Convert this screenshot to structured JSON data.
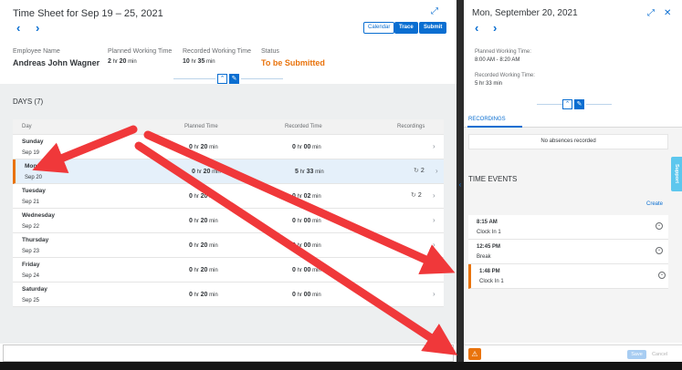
{
  "left": {
    "title": "Time Sheet for Sep 19 – 25, 2021",
    "buttons": {
      "calendar": "Calendar",
      "trace": "Trace",
      "submit": "Submit"
    },
    "employee": {
      "label": "Employee Name",
      "value": "Andreas John Wagner"
    },
    "planned": {
      "label": "Planned Working Time",
      "hr": "2",
      "hr_unit": "hr",
      "min": "20",
      "min_unit": "min"
    },
    "recorded": {
      "label": "Recorded Working Time",
      "hr": "10",
      "hr_unit": "hr",
      "min": "35",
      "min_unit": "min"
    },
    "status": {
      "label": "Status",
      "value": "To be Submitted"
    },
    "days_title": "DAYS (7)",
    "columns": {
      "day": "Day",
      "planned": "Planned Time",
      "recorded": "Recorded Time",
      "recordings": "Recordings"
    },
    "days": [
      {
        "day": "Sunday",
        "date": "Sep 19",
        "p_hr": "0",
        "p_min": "20",
        "r_hr": "0",
        "r_min": "00",
        "rec": "",
        "selected": false
      },
      {
        "day": "Monday",
        "date": "Sep 20",
        "p_hr": "0",
        "p_min": "20",
        "r_hr": "5",
        "r_min": "33",
        "rec": "2",
        "selected": true
      },
      {
        "day": "Tuesday",
        "date": "Sep 21",
        "p_hr": "0",
        "p_min": "20",
        "r_hr": "0",
        "r_min": "02",
        "rec": "2",
        "selected": false
      },
      {
        "day": "Wednesday",
        "date": "Sep 22",
        "p_hr": "0",
        "p_min": "20",
        "r_hr": "0",
        "r_min": "00",
        "rec": "",
        "selected": false
      },
      {
        "day": "Thursday",
        "date": "Sep 23",
        "p_hr": "0",
        "p_min": "20",
        "r_hr": "0",
        "r_min": "00",
        "rec": "",
        "selected": false
      },
      {
        "day": "Friday",
        "date": "Sep 24",
        "p_hr": "0",
        "p_min": "20",
        "r_hr": "0",
        "r_min": "00",
        "rec": "",
        "selected": false
      },
      {
        "day": "Saturday",
        "date": "Sep 25",
        "p_hr": "0",
        "p_min": "20",
        "r_hr": "0",
        "r_min": "00",
        "rec": "",
        "selected": false
      }
    ],
    "units": {
      "hr": "hr",
      "min": "min"
    }
  },
  "right": {
    "title": "Mon, September 20, 2021",
    "planned_label": "Planned Working Time:",
    "planned_value": "8:00 AM - 8:20 AM",
    "recorded_label": "Recorded Working Time:",
    "recorded_value": "5 hr 33 min",
    "tab_recordings": "RECORDINGS",
    "no_absences": "No absences recorded",
    "time_events_title": "TIME EVENTS",
    "create_link": "Create",
    "events": [
      {
        "time": "8:15 AM",
        "kind": "Clock In 1",
        "selected": false
      },
      {
        "time": "12:45 PM",
        "kind": "Break",
        "selected": false
      },
      {
        "time": "1:48 PM",
        "kind": "Clock In 1",
        "selected": true
      }
    ],
    "save": "Save",
    "cancel": "Cancel",
    "support": "Support"
  },
  "icons": {
    "prev": "chevron-left-icon",
    "next": "chevron-right-icon",
    "expand": "expand-icon",
    "close": "close-icon",
    "collapse": "chevron-up-icon",
    "pin": "pin-icon",
    "row_nav": "chevron-right-icon",
    "recording": "history-icon",
    "person": "person-icon",
    "warning": "warning-icon"
  },
  "colors": {
    "accent": "#0a6ed1",
    "status_orange": "#e9730c",
    "annotation_arrow": "#f0383a",
    "support_tab": "#5dc7ee"
  }
}
